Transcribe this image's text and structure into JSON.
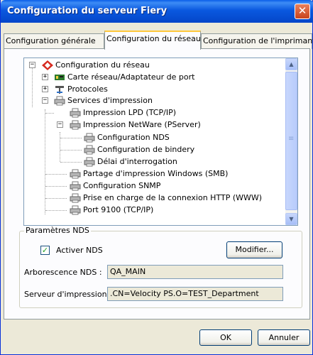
{
  "window": {
    "title": "Configuration du serveur Fiery",
    "close_glyph": "✕"
  },
  "tabs": [
    {
      "label": "Configuration générale"
    },
    {
      "label": "Configuration du réseau"
    },
    {
      "label": "Configuration de l'imprimante"
    }
  ],
  "tree": {
    "expand_glyph": "+",
    "collapse_glyph": "−",
    "items": [
      {
        "label": "Configuration du réseau",
        "icon": "network-root-icon"
      },
      {
        "label": "Carte réseau/Adaptateur de port",
        "icon": "network-card-icon"
      },
      {
        "label": "Protocoles",
        "icon": "protocol-icon"
      },
      {
        "label": "Services d'impression",
        "icon": "printer-icon"
      },
      {
        "label": "Impression LPD (TCP/IP)",
        "icon": "printer-icon"
      },
      {
        "label": "Impression NetWare (PServer)",
        "icon": "printer-icon"
      },
      {
        "label": "Configuration NDS",
        "icon": "printer-icon"
      },
      {
        "label": "Configuration de bindery",
        "icon": "printer-icon"
      },
      {
        "label": "Délai d'interrogation",
        "icon": "printer-icon"
      },
      {
        "label": "Partage d'impression Windows (SMB)",
        "icon": "printer-icon"
      },
      {
        "label": "Configuration SNMP",
        "icon": "printer-icon"
      },
      {
        "label": "Prise en charge de la connexion HTTP (WWW)",
        "icon": "printer-icon"
      },
      {
        "label": "Port 9100 (TCP/IP)",
        "icon": "printer-icon"
      }
    ]
  },
  "scrollbar": {
    "up_glyph": "▲",
    "down_glyph": "▼",
    "grip_glyph": "≡"
  },
  "nds": {
    "group_title": "Paramètres NDS",
    "enable_label": "Activer NDS",
    "enable_checked": true,
    "check_glyph": "✓",
    "modify_button": "Modifier...",
    "tree_label": "Arborescence NDS :",
    "tree_value": "QA_MAIN",
    "server_label": "Serveur d'impression :",
    "server_value": ".CN=Velocity PS.O=TEST_Department"
  },
  "footer": {
    "ok_label": "OK",
    "cancel_label": "Annuler"
  }
}
